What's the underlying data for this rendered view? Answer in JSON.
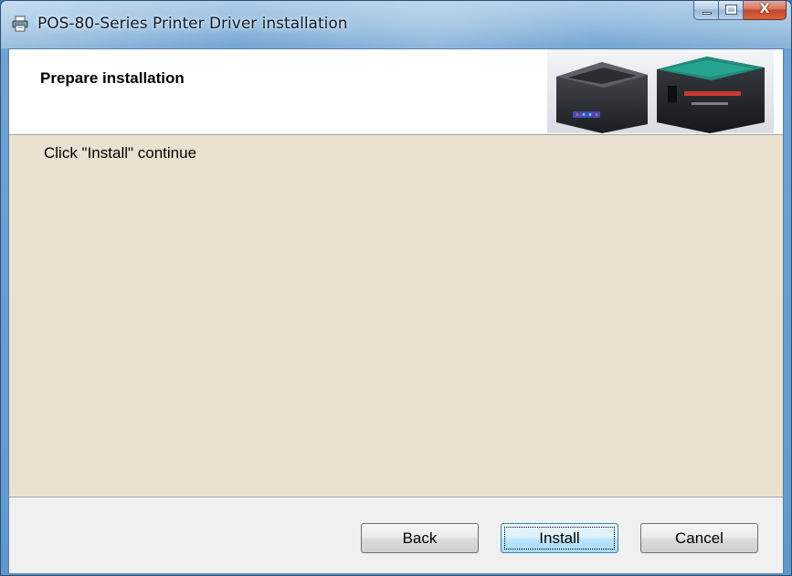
{
  "window": {
    "title": "POS-80-Series Printer Driver installation",
    "app_icon": "printer-icon",
    "close_glyph": "X",
    "colors": {
      "titlebar": "#8ab6dc",
      "close_button": "#c4452a",
      "header_background": "#ffffff",
      "body_background": "#ebe1d0",
      "button_bar": "#f0f0f0"
    }
  },
  "header": {
    "title": "Prepare installation",
    "banner_image": "thermal-printers-photo"
  },
  "body": {
    "message": "Click \"Install\" continue"
  },
  "buttons": {
    "back": "Back",
    "install": "Install",
    "cancel": "Cancel",
    "default": "install"
  }
}
